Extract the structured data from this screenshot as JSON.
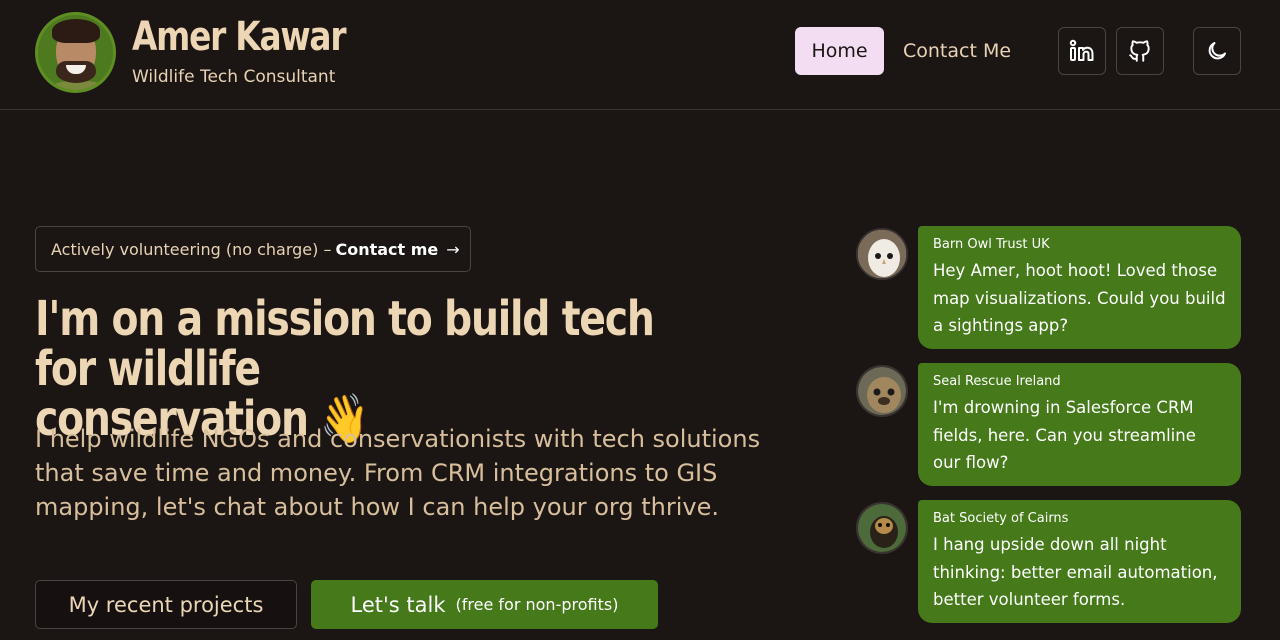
{
  "header": {
    "name": "Amer Kawar",
    "subtitle": "Wildlife Tech Consultant",
    "nav": {
      "home": "Home",
      "contact": "Contact Me"
    },
    "icons": [
      "linkedin-icon",
      "github-icon",
      "moon-icon"
    ]
  },
  "hero": {
    "badge_text": "Actively volunteering (no charge) –",
    "badge_cta": "Contact me",
    "badge_arrow": "→",
    "headline_line1": "I'm on a mission to build tech for wildlife",
    "headline_line2": "conservation 👋",
    "lead": "I help wildlife NGOs and conservationists with tech solutions that save time and money. From CRM integrations to GIS mapping, let's chat about how I can help your org thrive.",
    "btn_projects": "My recent projects",
    "btn_talk": "Let's talk",
    "btn_talk_note": "(free for non-profits)"
  },
  "chat": [
    {
      "org": "Barn Owl Trust UK",
      "message": "Hey Amer, hoot hoot! Loved those map visualizations. Could you build a sightings app?"
    },
    {
      "org": "Seal Rescue Ireland",
      "message": "I'm drowning in Salesforce CRM fields, here. Can you streamline our flow?"
    },
    {
      "org": "Bat Society of Cairns",
      "message": "I hang upside down all night thinking: better email automation, better volunteer forms."
    }
  ],
  "colors": {
    "background": "#1b1514",
    "accent_green": "#45791a",
    "home_pill": "#f2ddf2",
    "heading": "#ecd6b4"
  }
}
